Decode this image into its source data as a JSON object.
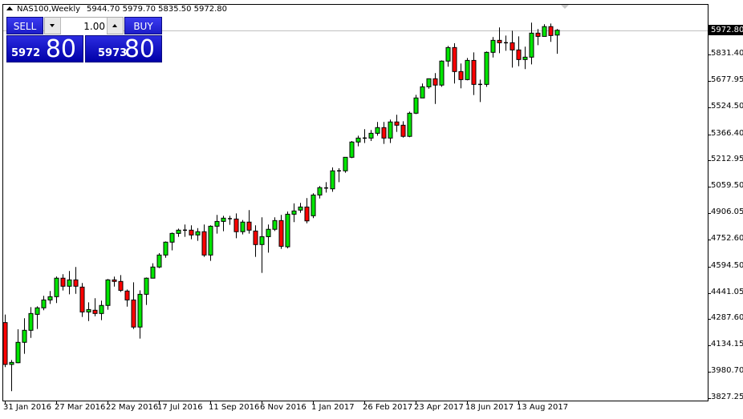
{
  "header": {
    "symbol_period": "NAS100,Weekly",
    "open": "5944.70",
    "high": "5979.70",
    "low": "5835.50",
    "close": "5972.80"
  },
  "trade_panel": {
    "sell_label": "SELL",
    "buy_label": "BUY",
    "lot_value": "1.00",
    "sell_price_small": "5972",
    "sell_price_big": "80",
    "buy_price_small": "5973",
    "buy_price_big": "80"
  },
  "current_price_label": "5972.80",
  "colors": {
    "bull": "#00e600",
    "bear": "#ff0000",
    "outline": "#000000",
    "bid_line": "#c0c0c0"
  },
  "chart_data": {
    "type": "candlestick",
    "title": "NAS100,Weekly",
    "ylim": [
      3827.25,
      6055
    ],
    "y_ticks": [
      "5831.40",
      "5677.95",
      "5524.50",
      "5366.40",
      "5212.95",
      "5059.50",
      "4906.05",
      "4752.60",
      "4594.50",
      "4441.05",
      "4287.60",
      "4134.15",
      "3980.70",
      "3827.25"
    ],
    "x_ticks": [
      {
        "label": "31 Jan 2016",
        "candle": 0
      },
      {
        "label": "27 Mar 2016",
        "candle": 8
      },
      {
        "label": "22 May 2016",
        "candle": 16
      },
      {
        "label": "17 Jul 2016",
        "candle": 24
      },
      {
        "label": "11 Sep 2016",
        "candle": 32
      },
      {
        "label": "6 Nov 2016",
        "candle": 40
      },
      {
        "label": "1 Jan 2017",
        "candle": 48
      },
      {
        "label": "26 Feb 2017",
        "candle": 56
      },
      {
        "label": "23 Apr 2017",
        "candle": 64
      },
      {
        "label": "18 Jun 2017",
        "candle": 72
      },
      {
        "label": "13 Aug 2017",
        "candle": 80
      }
    ],
    "bid": 5972.8,
    "ohlc": [
      [
        4268,
        4315,
        4008,
        4024
      ],
      [
        4024,
        4050,
        3868,
        4036
      ],
      [
        4034,
        4229,
        4031,
        4153
      ],
      [
        4153,
        4293,
        4086,
        4223
      ],
      [
        4223,
        4358,
        4179,
        4321
      ],
      [
        4316,
        4363,
        4231,
        4354
      ],
      [
        4354,
        4424,
        4340,
        4400
      ],
      [
        4400,
        4452,
        4377,
        4419
      ],
      [
        4419,
        4537,
        4382,
        4527
      ],
      [
        4527,
        4550,
        4455,
        4480
      ],
      [
        4480,
        4569,
        4433,
        4517
      ],
      [
        4517,
        4592,
        4436,
        4480
      ],
      [
        4475,
        4499,
        4301,
        4330
      ],
      [
        4330,
        4386,
        4277,
        4344
      ],
      [
        4340,
        4410,
        4305,
        4321
      ],
      [
        4321,
        4396,
        4282,
        4368
      ],
      [
        4368,
        4522,
        4343,
        4517
      ],
      [
        4517,
        4536,
        4478,
        4508
      ],
      [
        4508,
        4545,
        4447,
        4456
      ],
      [
        4452,
        4461,
        4361,
        4400
      ],
      [
        4400,
        4503,
        4231,
        4242
      ],
      [
        4242,
        4456,
        4175,
        4433
      ],
      [
        4433,
        4531,
        4371,
        4527
      ],
      [
        4527,
        4614,
        4527,
        4592
      ],
      [
        4592,
        4673,
        4586,
        4662
      ],
      [
        4662,
        4741,
        4646,
        4737
      ],
      [
        4737,
        4793,
        4689,
        4788
      ],
      [
        4788,
        4816,
        4768,
        4807
      ],
      [
        4807,
        4840,
        4768,
        4807
      ],
      [
        4807,
        4835,
        4754,
        4779
      ],
      [
        4779,
        4819,
        4745,
        4798
      ],
      [
        4798,
        4840,
        4651,
        4662
      ],
      [
        4662,
        4835,
        4628,
        4830
      ],
      [
        4830,
        4896,
        4787,
        4858
      ],
      [
        4858,
        4891,
        4801,
        4877
      ],
      [
        4874,
        4891,
        4838,
        4874
      ],
      [
        4872,
        4905,
        4760,
        4798
      ],
      [
        4798,
        4866,
        4782,
        4854
      ],
      [
        4854,
        4924,
        4787,
        4807
      ],
      [
        4802,
        4835,
        4651,
        4723
      ],
      [
        4723,
        4882,
        4558,
        4769
      ],
      [
        4769,
        4840,
        4676,
        4812
      ],
      [
        4812,
        4882,
        4802,
        4863
      ],
      [
        4863,
        4896,
        4698,
        4713
      ],
      [
        4710,
        4916,
        4701,
        4900
      ],
      [
        4900,
        4963,
        4854,
        4919
      ],
      [
        4924,
        4966,
        4908,
        4942
      ],
      [
        4942,
        4994,
        4847,
        4861
      ],
      [
        4891,
        5022,
        4877,
        5012
      ],
      [
        5012,
        5064,
        4992,
        5055
      ],
      [
        5053,
        5087,
        5026,
        5053
      ],
      [
        5048,
        5173,
        5031,
        5153
      ],
      [
        5153,
        5168,
        5087,
        5153
      ],
      [
        5153,
        5232,
        5142,
        5232
      ],
      [
        5232,
        5327,
        5227,
        5321
      ],
      [
        5321,
        5358,
        5296,
        5344
      ],
      [
        5344,
        5396,
        5315,
        5344
      ],
      [
        5344,
        5391,
        5327,
        5372
      ],
      [
        5372,
        5438,
        5358,
        5405
      ],
      [
        5405,
        5438,
        5310,
        5344
      ],
      [
        5344,
        5452,
        5315,
        5438
      ],
      [
        5438,
        5480,
        5380,
        5419
      ],
      [
        5419,
        5442,
        5347,
        5354
      ],
      [
        5354,
        5498,
        5349,
        5489
      ],
      [
        5489,
        5596,
        5484,
        5578
      ],
      [
        5578,
        5662,
        5578,
        5643
      ],
      [
        5643,
        5690,
        5632,
        5690
      ],
      [
        5690,
        5723,
        5543,
        5653
      ],
      [
        5653,
        5797,
        5643,
        5793
      ],
      [
        5793,
        5881,
        5760,
        5872
      ],
      [
        5872,
        5897,
        5662,
        5732
      ],
      [
        5732,
        5779,
        5634,
        5685
      ],
      [
        5685,
        5811,
        5681,
        5797
      ],
      [
        5797,
        5844,
        5595,
        5657
      ],
      [
        5657,
        5685,
        5554,
        5657
      ],
      [
        5657,
        5849,
        5643,
        5844
      ],
      [
        5844,
        5933,
        5814,
        5914
      ],
      [
        5914,
        5989,
        5839,
        5900
      ],
      [
        5900,
        5942,
        5853,
        5900
      ],
      [
        5900,
        5970,
        5755,
        5858
      ],
      [
        5858,
        5937,
        5763,
        5802
      ],
      [
        5802,
        5877,
        5746,
        5816
      ],
      [
        5816,
        6017,
        5774,
        5956
      ],
      [
        5956,
        5980,
        5886,
        5937
      ],
      [
        5937,
        6008,
        5937,
        5994
      ],
      [
        5994,
        6012,
        5905,
        5942
      ],
      [
        5944.7,
        5979.7,
        5835.5,
        5972.8
      ]
    ]
  }
}
